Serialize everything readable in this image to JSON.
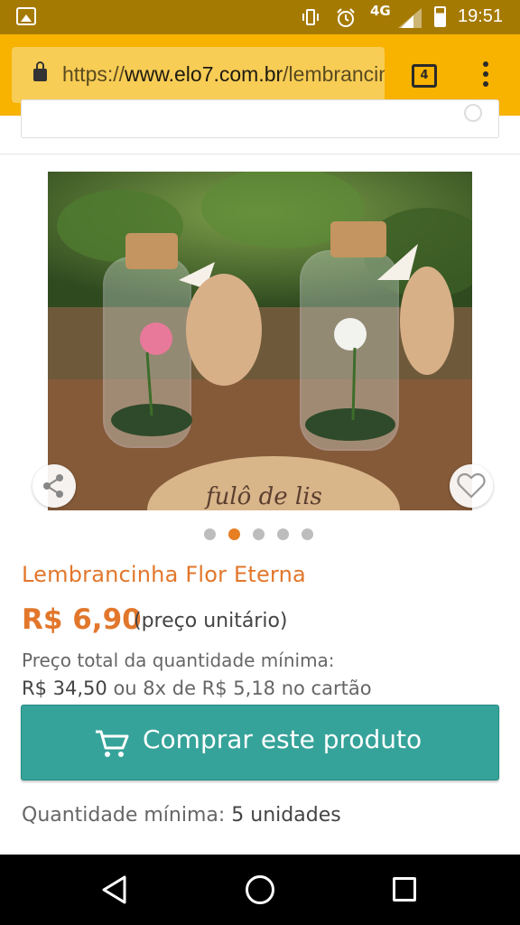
{
  "status_bar": {
    "network": "4G",
    "time": "19:51"
  },
  "browser": {
    "url_scheme": "https://",
    "url_host": "www.elo7.com.br",
    "url_path": "/lembrancinha-flor-eterna",
    "tab_count": "4"
  },
  "product": {
    "image_caption": "fulô de lis",
    "carousel": {
      "count": 5,
      "active_index": 1
    },
    "title": "Lembrancinha Flor Eterna",
    "price": "R$ 6,90",
    "price_note": "(preço unitário)",
    "total_label": "Preço total da quantidade mínima:",
    "total_value": "R$ 34,50",
    "installments": "ou 8x de R$ 5,18 no cartão",
    "buy_label": "Comprar este produto",
    "min_qty_label": "Quantidade mínima:",
    "min_qty_value": "5 unidades"
  },
  "colors": {
    "status_bar": "#a57a02",
    "toolbar": "#f8b200",
    "accent": "#e2772b",
    "buy_button": "#36a39a"
  }
}
